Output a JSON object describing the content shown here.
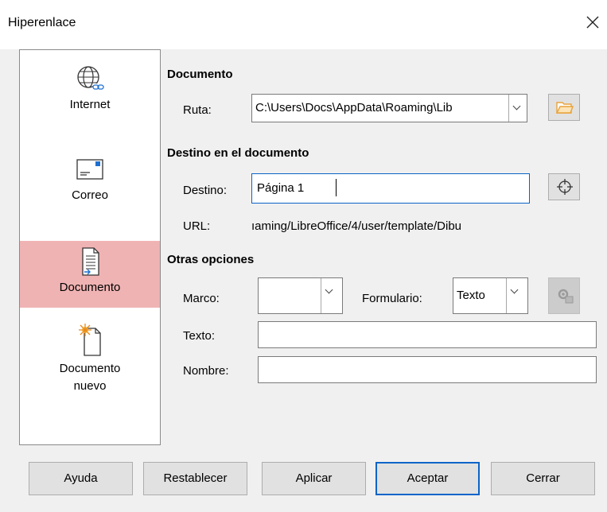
{
  "window": {
    "title": "Hiperenlace"
  },
  "sidebar": {
    "items": [
      {
        "label": "Internet",
        "icon": "globe-link-icon",
        "selected": false
      },
      {
        "label": "Correo",
        "icon": "envelope-icon",
        "selected": false
      },
      {
        "label": "Documento",
        "icon": "document-icon",
        "selected": true
      },
      {
        "label": "Documento nuevo",
        "label_line1": "Documento",
        "label_line2": "nuevo",
        "icon": "new-document-icon",
        "selected": false
      }
    ]
  },
  "documento": {
    "section_title": "Documento",
    "ruta_label": "Ruta:",
    "ruta_value": "C:\\Users\\Docs\\AppData\\Roaming\\Lib",
    "open_file_icon": "folder-open-icon"
  },
  "destino": {
    "section_title": "Destino en el documento",
    "destino_label": "Destino:",
    "destino_value": "Página 1",
    "target_icon": "target-crosshair-icon",
    "url_label": "URL:",
    "url_value": "ıaming/LibreOffice/4/user/template/Dibu"
  },
  "opciones": {
    "section_title": "Otras opciones",
    "marco_label": "Marco:",
    "marco_value": "",
    "formulario_label": "Formulario:",
    "formulario_value": "Texto",
    "events_icon": "gear-macro-icon",
    "texto_label": "Texto:",
    "texto_value": "",
    "nombre_label": "Nombre:",
    "nombre_value": ""
  },
  "buttons": {
    "ayuda": "Ayuda",
    "restablecer": "Restablecer",
    "aplicar": "Aplicar",
    "aceptar": "Aceptar",
    "cerrar": "Cerrar"
  },
  "colors": {
    "selected_bg": "#f0b3b3",
    "focus_border": "#0a64c8",
    "folder_orange": "#e8a33a"
  }
}
